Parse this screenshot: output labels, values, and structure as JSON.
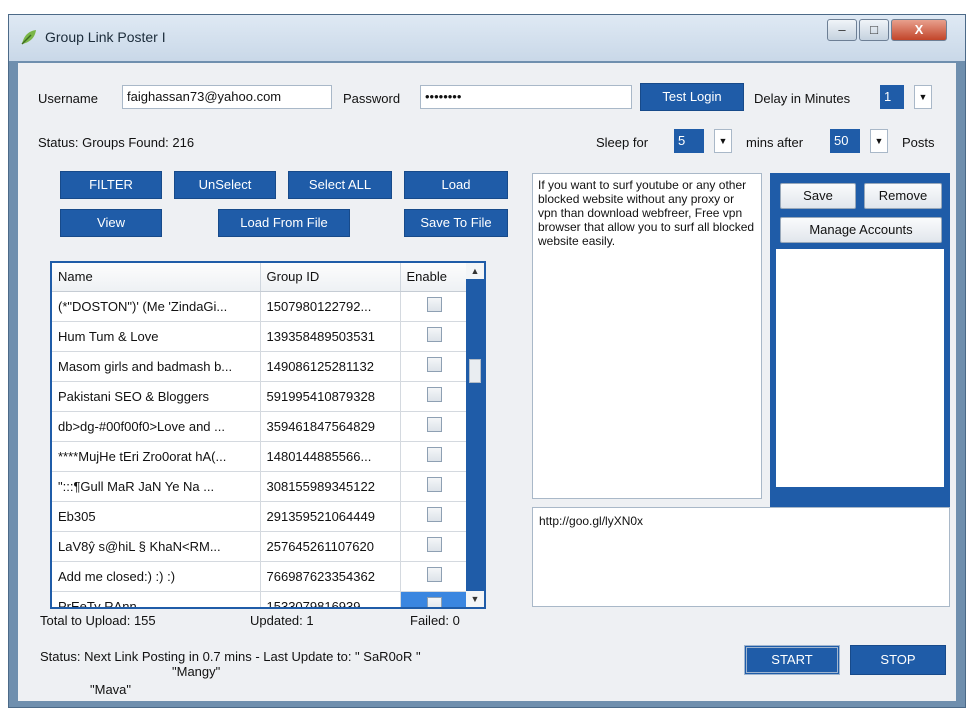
{
  "window": {
    "title": "Group Link Poster I",
    "controls": {
      "minimize": "–",
      "maximize": "□",
      "close": "X"
    }
  },
  "login": {
    "username_label": "Username",
    "username_value": "faighassan73@yahoo.com",
    "password_label": "Password",
    "password_value": "••••••••",
    "test_login_label": "Test Login",
    "delay_label": "Delay in Minutes",
    "delay_value": "1"
  },
  "status_groups": "Status:  Groups Found: 216",
  "sleep": {
    "sleep_for_label": "Sleep for",
    "sleep_value": "5",
    "mins_after_label": "mins after",
    "posts_value": "50",
    "posts_label": "Posts"
  },
  "buttons": {
    "filter": "FILTER",
    "unselect": "UnSelect",
    "select_all": "Select ALL",
    "load": "Load",
    "view": "View",
    "load_from_file": "Load From File",
    "save_to_file": "Save To File"
  },
  "table": {
    "headers": [
      "Name",
      "Group ID",
      "Enable"
    ],
    "rows": [
      {
        "name": "(*\"DOSTON\")' (Me 'ZindaGi...",
        "id": "1507980122792..."
      },
      {
        "name": "Hum Tum & Love",
        "id": "139358489503531"
      },
      {
        "name": "Masom girls and badmash b...",
        "id": "149086125281132"
      },
      {
        "name": "Pakistani SEO & Bloggers",
        "id": "591995410879328"
      },
      {
        "name": "db>dg-#00f00f0>Love and ...",
        "id": "359461847564829"
      },
      {
        "name": "****MujHe tEri Zro0orat hA(...",
        "id": "1480144885566..."
      },
      {
        "name": "\":::¶Gull MaR JaN Ye Na ...",
        "id": "308155989345122"
      },
      {
        "name": "Eb305",
        "id": "291359521064449"
      },
      {
        "name": "LaV8ŷ s@hiL § KhaN<RM...",
        "id": "257645261107620"
      },
      {
        "name": "Add me closed:) :) :)",
        "id": "766987623354362"
      },
      {
        "name": "PrEeTy RAnn",
        "id": "1533079816939..."
      }
    ]
  },
  "info_text": "If you want to surf youtube or any other blocked website without any proxy or vpn than download webfreer, Free vpn browser that allow you to surf all blocked website easily.",
  "accounts": {
    "save_label": "Save",
    "remove_label": "Remove",
    "manage_label": "Manage Accounts"
  },
  "link_text": "http://goo.gl/lyXN0x",
  "stats": {
    "total": "Total to Upload: 155",
    "updated": "Updated: 1",
    "failed": "Failed: 0"
  },
  "status_line": {
    "line1": "Status:  Next Link Posting in 0.7 mins - Last Update to: \" SaR0oR \"",
    "line2": "\"Mangy\"",
    "line3": "\"Mava\""
  },
  "actions": {
    "start_label": "START",
    "stop_label": "STOP"
  },
  "colors": {
    "accent": "#1f5ca8",
    "frame": "#6f8fae",
    "client": "#eef0f3"
  }
}
